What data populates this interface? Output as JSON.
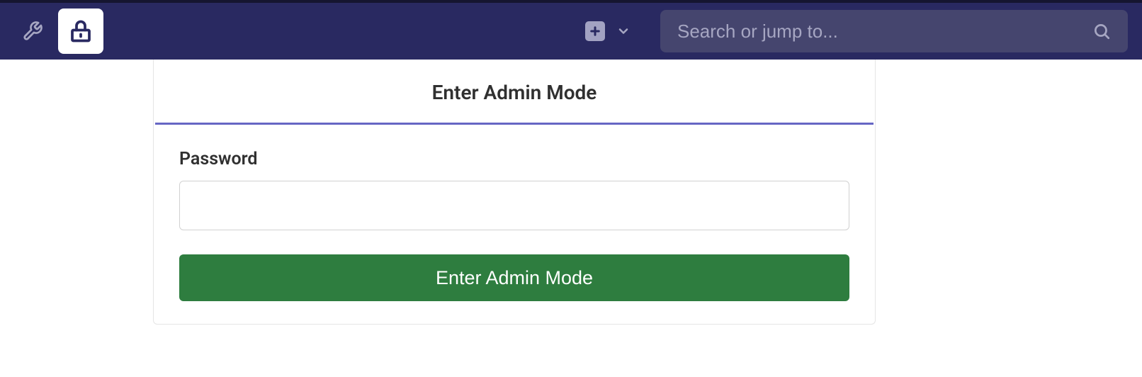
{
  "topbar": {
    "search_placeholder": "Search or jump to..."
  },
  "card": {
    "title": "Enter Admin Mode",
    "password_label": "Password",
    "submit_label": "Enter Admin Mode"
  }
}
